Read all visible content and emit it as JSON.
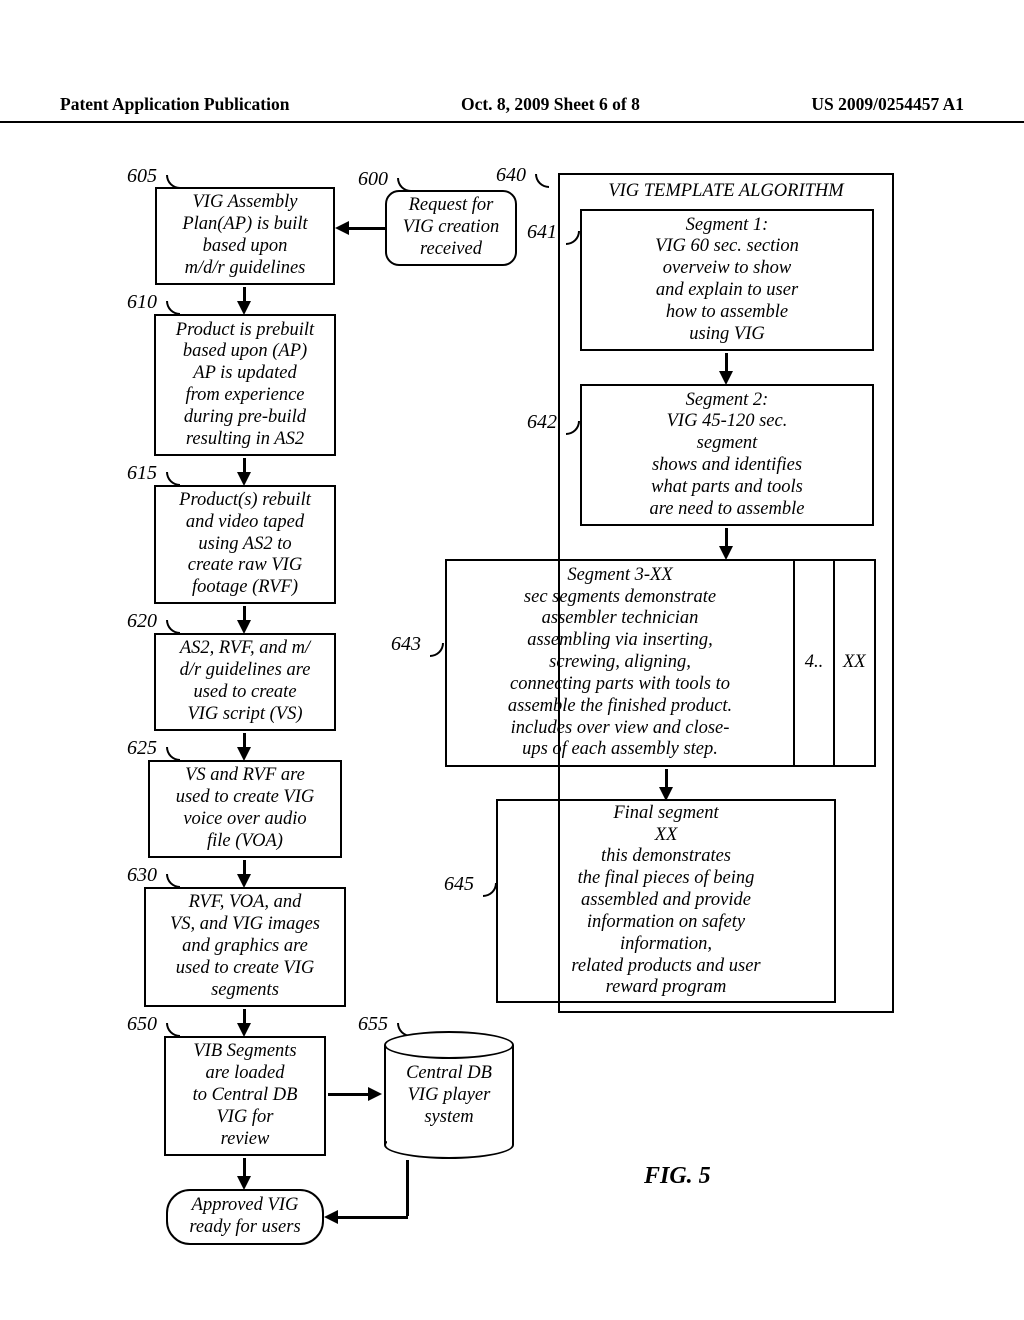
{
  "header": {
    "left": "Patent Application Publication",
    "mid": "Oct. 8, 2009   Sheet 6 of 8",
    "right": "US 2009/0254457 A1"
  },
  "refs": {
    "r600": "600",
    "r605": "605",
    "r610": "610",
    "r615": "615",
    "r620": "620",
    "r625": "625",
    "r630": "630",
    "r640": "640",
    "r641": "641",
    "r642": "642",
    "r643": "643",
    "r645": "645",
    "r650": "650",
    "r655": "655"
  },
  "left": {
    "b605": "VIG Assembly\nPlan(AP) is built\nbased upon\nm/d/r guidelines",
    "b610": "Product is prebuilt\nbased upon (AP)\nAP is updated\nfrom experience\nduring pre-build\nresulting in AS2",
    "b615": "Product(s) rebuilt\nand video taped\nusing AS2 to\ncreate raw VIG\nfootage (RVF)",
    "b620": "AS2, RVF, and m/\nd/r guidelines are\nused to create\nVIG script (VS)",
    "b625": "VS and RVF are\nused to create VIG\nvoice over audio\nfile (VOA)",
    "b630": "RVF, VOA, and\nVS, and VIG images\nand graphics are\nused to create VIG\nsegments",
    "b650": "VIB Segments\nare loaded\nto Central DB\nVIG for\nreview",
    "final": "Approved VIG\nready for users"
  },
  "center": {
    "b600": "Request for\nVIG creation\nreceived",
    "cyl655": "Central DB\nVIG player\nsystem"
  },
  "right": {
    "title": "VIG TEMPLATE ALGORITHM",
    "b641": "Segment 1:\nVIG 60 sec. section\noverveiw to show\nand explain to user\nhow to assemble\nusing VIG",
    "b642": "Segment 2:\nVIG 45-120 sec.\nsegment\nshows and identifies\nwhat parts and tools\nare need to assemble",
    "seg3": "Segment 3-XX\nsec segments demonstrate\nassembler technician\nassembling via inserting,\nscrewing, aligning,\nconnecting parts with tools to\nassemble the finished product.\nincludes over view and close-\nups of each assembly step.",
    "seg4": "4..",
    "segxx": "XX",
    "b645": "Final segment\nXX\nthis demonstrates\nthe final pieces of being\nassembled and provide\ninformation on safety\ninformation,\nrelated products and user\nreward program"
  },
  "fig": "FIG. 5"
}
